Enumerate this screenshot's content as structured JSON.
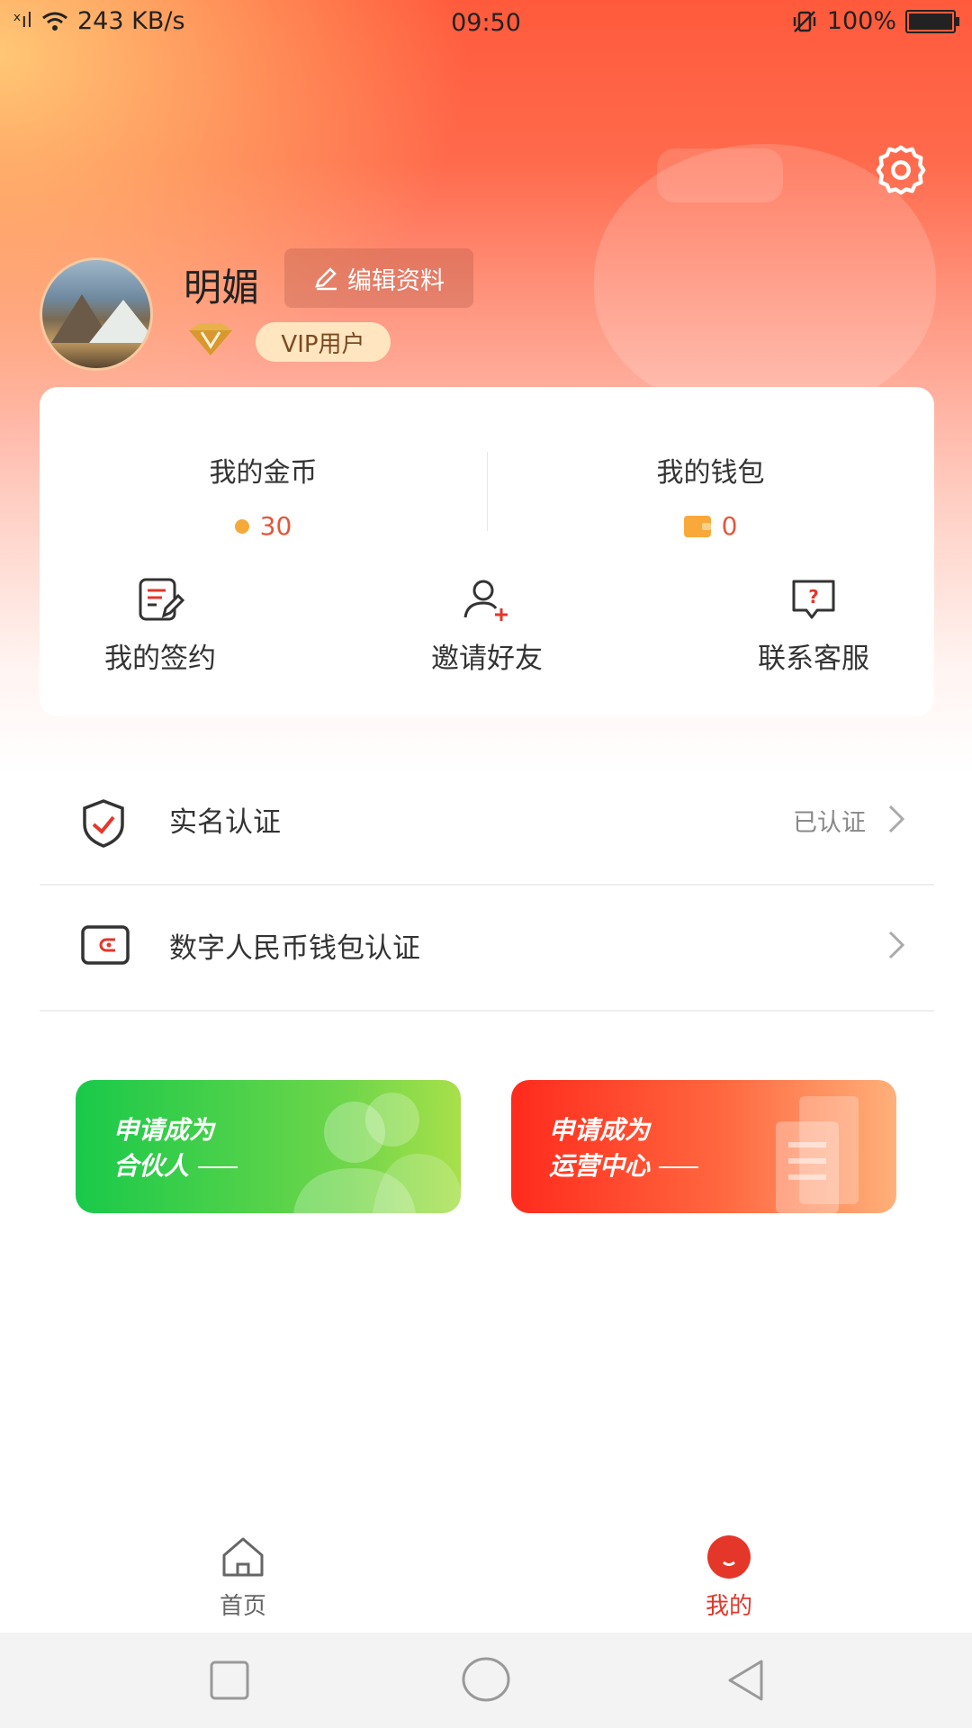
{
  "status_bar": {
    "signal": "ˣıl",
    "speed": "243 KB/s",
    "time": "09:50",
    "battery_text": "100%",
    "battery_level": 1.0
  },
  "profile": {
    "name": "明媚",
    "edit_label": "编辑资料",
    "vip_label": "VIP用户"
  },
  "stats": {
    "coins": {
      "title": "我的金币",
      "value": "30"
    },
    "wallet": {
      "title": "我的钱包",
      "value": "0"
    }
  },
  "quick_actions": [
    {
      "label": "我的签约",
      "icon": "contract-icon"
    },
    {
      "label": "邀请好友",
      "icon": "invite-friend-icon"
    },
    {
      "label": "联系客服",
      "icon": "customer-service-icon"
    }
  ],
  "menu": [
    {
      "label": "实名认证",
      "status": "已认证",
      "icon": "shield-check-icon"
    },
    {
      "label": "数字人民币钱包认证",
      "status": "",
      "icon": "wallet-icon"
    }
  ],
  "banners": [
    {
      "line1": "申请成为",
      "line2": "合伙人"
    },
    {
      "line1": "申请成为",
      "line2": "运营中心"
    }
  ],
  "tabs": [
    {
      "label": "首页",
      "active": false,
      "icon": "home-icon"
    },
    {
      "label": "我的",
      "active": true,
      "icon": "profile-icon"
    }
  ],
  "colors": {
    "accent": "#e4372a",
    "coin": "#f4a93a",
    "inactive_tab": "#666666"
  }
}
